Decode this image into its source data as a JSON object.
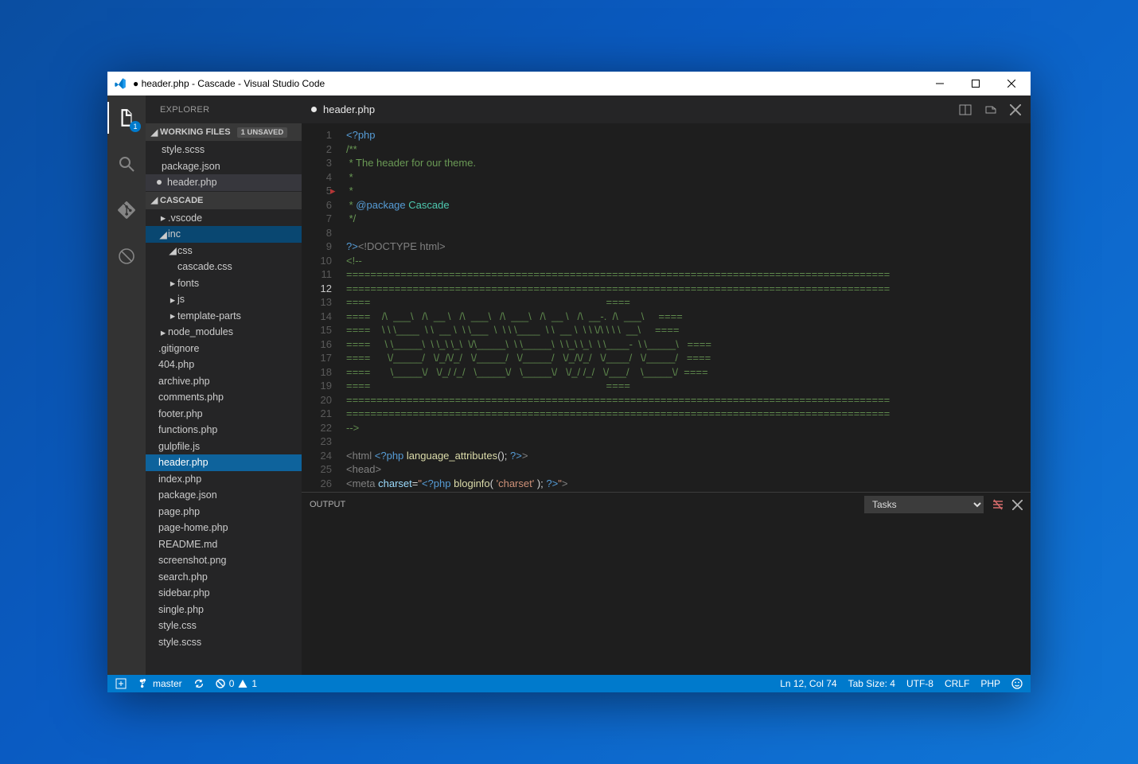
{
  "window": {
    "title": "● header.php - Cascade - Visual Studio Code"
  },
  "activity": {
    "explorer_badge": "1"
  },
  "sidebar": {
    "title": "EXPLORER",
    "working_header": "WORKING FILES",
    "working_tag": "1 UNSAVED",
    "working": [
      {
        "label": "style.scss",
        "mod": false
      },
      {
        "label": "package.json",
        "mod": false
      },
      {
        "label": "header.php",
        "mod": true
      }
    ],
    "project_header": "CASCADE",
    "tree_vscode": ".vscode",
    "tree_inc": "inc",
    "tree_css": "css",
    "tree_cascade_css": "cascade.css",
    "tree_fonts": "fonts",
    "tree_js": "js",
    "tree_template": "template-parts",
    "tree_node": "node_modules",
    "files": [
      ".gitignore",
      "404.php",
      "archive.php",
      "comments.php",
      "footer.php",
      "functions.php",
      "gulpfile.js",
      "header.php",
      "index.php",
      "package.json",
      "page.php",
      "page-home.php",
      "README.md",
      "screenshot.png",
      "search.php",
      "sidebar.php",
      "single.php",
      "style.css",
      "style.scss"
    ]
  },
  "tab": {
    "label": "header.php"
  },
  "code": {
    "lines": [
      {
        "n": 1,
        "html": "<span class='tk-php'>&lt;?php</span>"
      },
      {
        "n": 2,
        "html": "<span class='tk-doc'>/**</span>"
      },
      {
        "n": 3,
        "html": "<span class='tk-doc'> * The header for our theme.</span>"
      },
      {
        "n": 4,
        "html": "<span class='tk-doc'> *</span>"
      },
      {
        "n": 5,
        "html": "<span class='tk-doc'> *</span>"
      },
      {
        "n": 6,
        "html": "<span class='tk-doc'> * </span><span class='tk-pkg'>@package</span><span class='tk-doc'> </span><span class='tk-name'>Cascade</span>"
      },
      {
        "n": 7,
        "html": "<span class='tk-doc'> */</span>"
      },
      {
        "n": 8,
        "html": ""
      },
      {
        "n": 9,
        "html": "<span class='tk-php'>?&gt;</span><span class='tk-html'>&lt;!DOCTYPE html&gt;</span>"
      },
      {
        "n": 10,
        "html": "<span class='tk-cmt2'>&lt;!--</span>"
      },
      {
        "n": 11,
        "html": "<span class='tk-cmt2'>==========================================================================================</span>"
      },
      {
        "n": 12,
        "html": "<span class='tk-cmt2'>==========================================================================================</span>"
      },
      {
        "n": 13,
        "html": "<span class='tk-cmt2'>====                                                                                  ====</span>"
      },
      {
        "n": 14,
        "html": "<span class='tk-cmt2'>====    /\\  ___\\   /\\  __ \\   /\\  ___\\   /\\  ___\\   /\\  __ \\   /\\  __-.  /\\  ___\\     ====</span>"
      },
      {
        "n": 15,
        "html": "<span class='tk-cmt2'>====    \\ \\ \\____  \\ \\  __ \\  \\ \\___  \\  \\ \\ \\____  \\ \\  __ \\  \\ \\ \\/\\ \\ \\ \\  __\\     ====</span>"
      },
      {
        "n": 16,
        "html": "<span class='tk-cmt2'>====     \\ \\_____\\  \\ \\_\\ \\_\\  \\/\\_____\\  \\ \\_____\\  \\ \\_\\ \\_\\  \\ \\____-  \\ \\_____\\   ====</span>"
      },
      {
        "n": 17,
        "html": "<span class='tk-cmt2'>====      \\/_____/   \\/_/\\/_/   \\/_____/   \\/_____/   \\/_/\\/_/   \\/____/   \\/_____/   ====</span>"
      },
      {
        "n": 18,
        "html": "<span class='tk-cmt2'>====       \\_____\\/   \\/_/ /_/   \\_____\\/   \\_____\\/   \\/_/ /_/   \\/___/    \\_____\\/  ====</span>"
      },
      {
        "n": 19,
        "html": "<span class='tk-cmt2'>====                                                                                  ====</span>"
      },
      {
        "n": 20,
        "html": "<span class='tk-cmt2'>==========================================================================================</span>"
      },
      {
        "n": 21,
        "html": "<span class='tk-cmt2'>==========================================================================================</span>"
      },
      {
        "n": 22,
        "html": "<span class='tk-cmt2'>--&gt;</span>"
      },
      {
        "n": 23,
        "html": ""
      },
      {
        "n": 24,
        "html": "<span class='tk-html'>&lt;html </span><span class='tk-php'>&lt;?php</span><span class='tk-white'> </span><span class='tk-fn'>language_attributes</span><span class='tk-white'>(); </span><span class='tk-php'>?&gt;</span><span class='tk-html'>&gt;</span>"
      },
      {
        "n": 25,
        "html": "<span class='tk-html'>&lt;head&gt;</span>"
      },
      {
        "n": 26,
        "html": "<span class='tk-html'>&lt;meta </span><span class='tk-attr'>charset</span><span class='tk-white'>=</span><span class='tk-str'>\"</span><span class='tk-php'>&lt;?php</span><span class='tk-white'> </span><span class='tk-fn'>bloginfo</span><span class='tk-white'>( </span><span class='tk-str'>'charset'</span><span class='tk-white'> ); </span><span class='tk-php'>?&gt;</span><span class='tk-str'>\"</span><span class='tk-html'>&gt;</span>"
      }
    ]
  },
  "panel": {
    "title": "OUTPUT",
    "select": "Tasks"
  },
  "status": {
    "branch": "master",
    "errors": "0",
    "warnings": "1",
    "pos": "Ln 12, Col 74",
    "tabsize": "Tab Size: 4",
    "encoding": "UTF-8",
    "eol": "CRLF",
    "lang": "PHP"
  }
}
